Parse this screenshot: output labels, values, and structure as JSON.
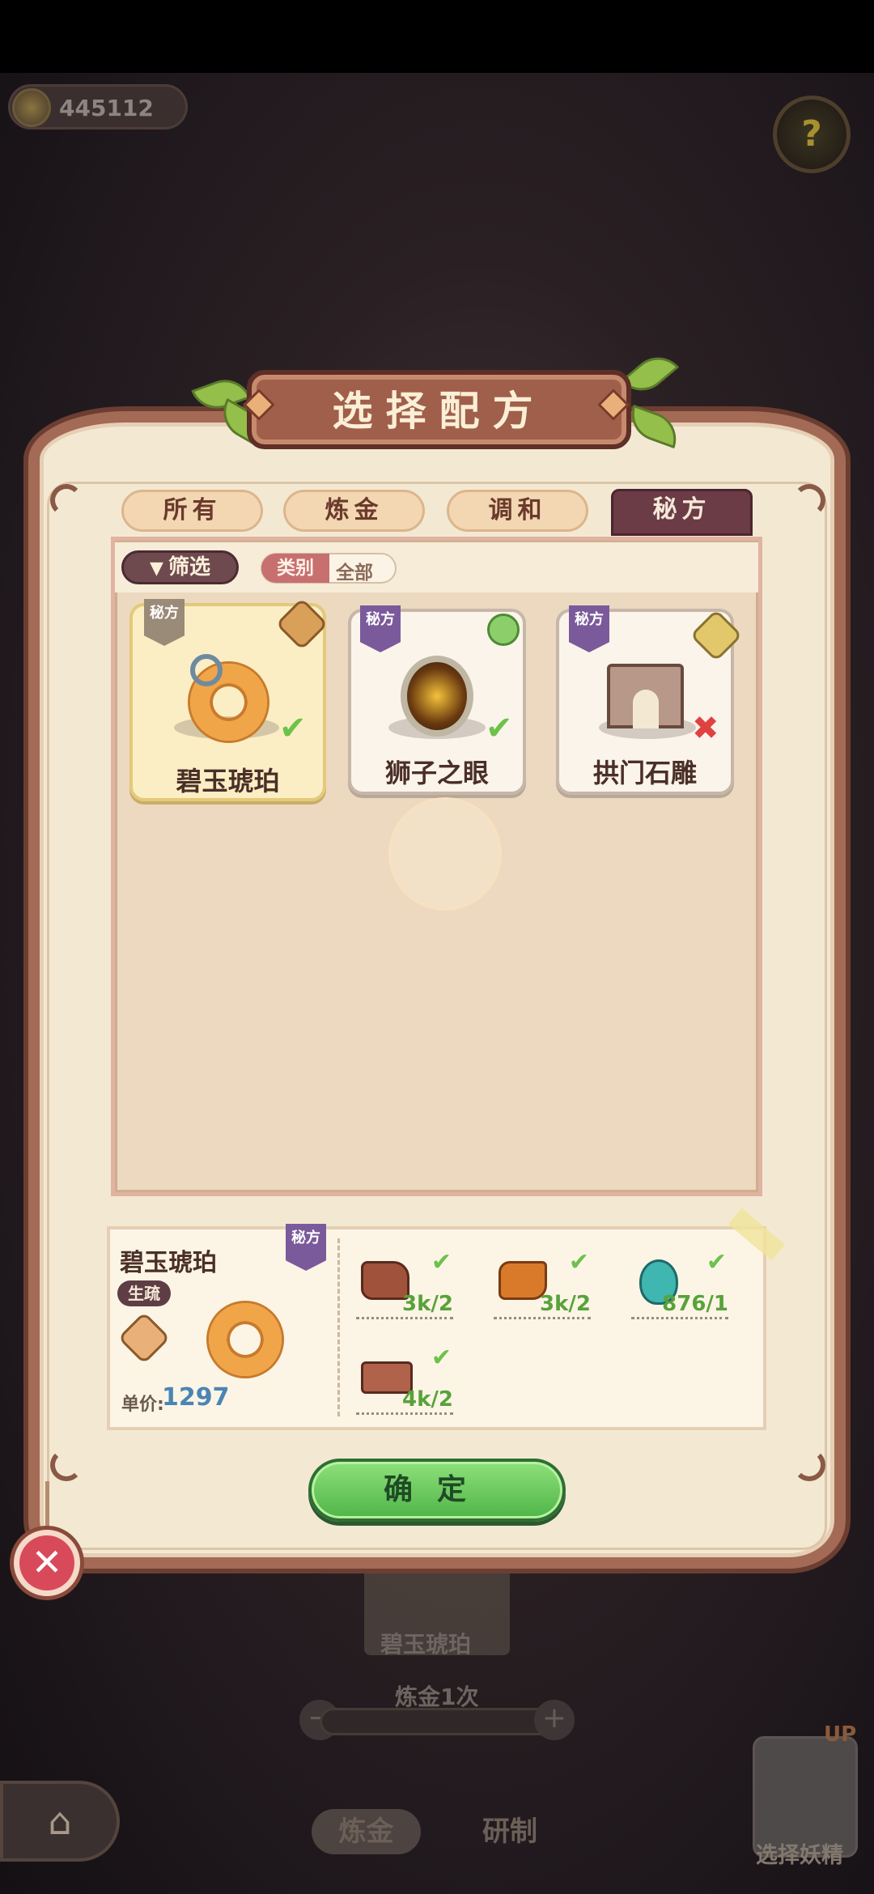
{
  "hud": {
    "coins": "445112",
    "help_symbol": "?"
  },
  "dialog": {
    "title": "选择配方",
    "tabs": [
      {
        "label": "所有",
        "active": false
      },
      {
        "label": "炼金",
        "active": false
      },
      {
        "label": "调和",
        "active": false
      },
      {
        "label": "秘方",
        "active": true
      }
    ],
    "filter": {
      "button_label": "筛选",
      "category_label": "类别",
      "category_value": "全部"
    },
    "recipes": [
      {
        "name": "碧玉琥珀",
        "tag": "秘方",
        "status": "check",
        "selected": true
      },
      {
        "name": "狮子之眼",
        "tag": "秘方",
        "status": "check",
        "selected": false
      },
      {
        "name": "拱门石雕",
        "tag": "秘方",
        "status": "cross",
        "selected": false
      }
    ],
    "detail": {
      "name": "碧玉琥珀",
      "badge": "生疏",
      "tag": "秘方",
      "price_label": "单价:",
      "price_value": "1297",
      "ingredients": [
        {
          "qty": "3k/2"
        },
        {
          "qty": "3k/2"
        },
        {
          "qty": "876/1"
        },
        {
          "qty": "4k/2"
        }
      ]
    },
    "confirm_label": "确定",
    "close_symbol": "✕"
  },
  "background": {
    "card_name": "碧玉琥珀",
    "alch_count_text": "炼金1次",
    "tab_alch": "炼金",
    "tab_research": "研制",
    "up_tag": "UP",
    "select_spirit": "选择妖精",
    "minus": "−",
    "plus": "+",
    "home_symbol": "⌂"
  },
  "colors": {
    "accent_green": "#58a23a",
    "price_blue": "#4b84b5",
    "active_tab": "#6b3b46",
    "cross_red": "#e04242"
  }
}
